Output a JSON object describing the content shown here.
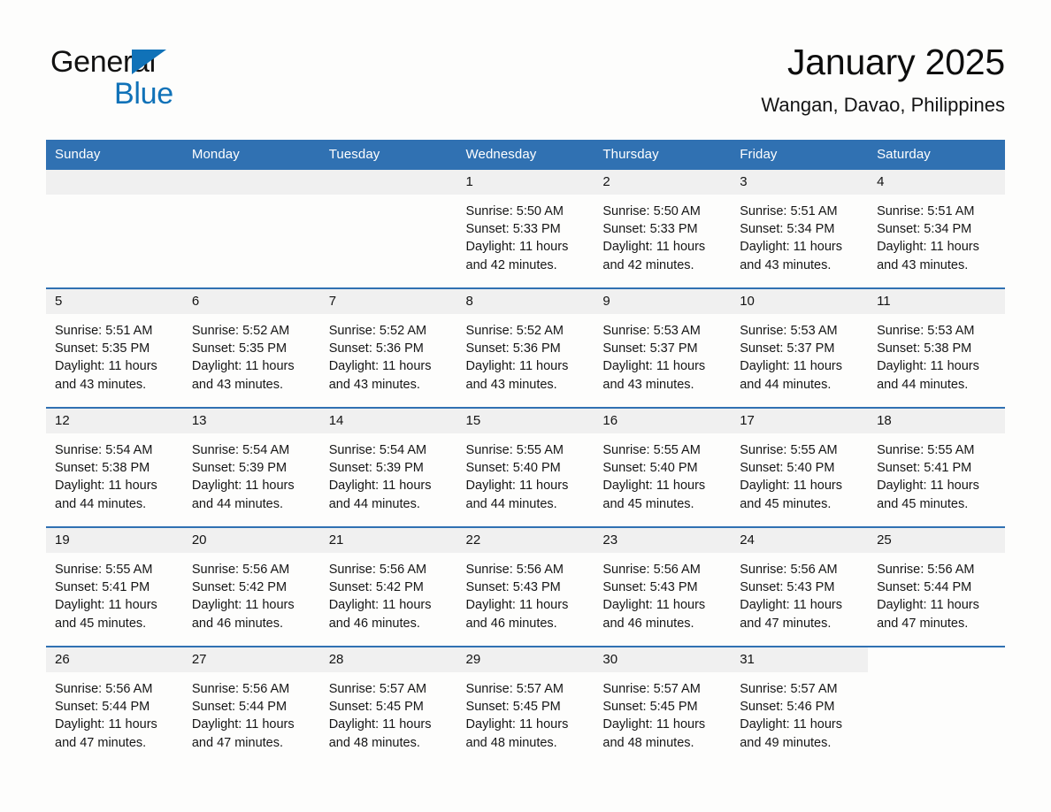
{
  "brand": {
    "name_part1": "General",
    "name_part2": "Blue"
  },
  "header": {
    "title": "January 2025",
    "location": "Wangan, Davao, Philippines"
  },
  "colors": {
    "header_blue": "#3071b2",
    "brand_blue": "#1072b8",
    "daynum_band": "#f0f0f0",
    "page_background": "#fdfdfc"
  },
  "weekdays": [
    "Sunday",
    "Monday",
    "Tuesday",
    "Wednesday",
    "Thursday",
    "Friday",
    "Saturday"
  ],
  "labels": {
    "sunrise_prefix": "Sunrise:",
    "sunset_prefix": "Sunset:",
    "daylight_prefix": "Daylight:"
  },
  "weeks": [
    [
      {
        "day": "",
        "blank": true
      },
      {
        "day": "",
        "blank": true
      },
      {
        "day": "",
        "blank": true
      },
      {
        "day": "1",
        "sunrise": "Sunrise: 5:50 AM",
        "sunset": "Sunset: 5:33 PM",
        "daylight": "Daylight: 11 hours and 42 minutes."
      },
      {
        "day": "2",
        "sunrise": "Sunrise: 5:50 AM",
        "sunset": "Sunset: 5:33 PM",
        "daylight": "Daylight: 11 hours and 42 minutes."
      },
      {
        "day": "3",
        "sunrise": "Sunrise: 5:51 AM",
        "sunset": "Sunset: 5:34 PM",
        "daylight": "Daylight: 11 hours and 43 minutes."
      },
      {
        "day": "4",
        "sunrise": "Sunrise: 5:51 AM",
        "sunset": "Sunset: 5:34 PM",
        "daylight": "Daylight: 11 hours and 43 minutes."
      }
    ],
    [
      {
        "day": "5",
        "sunrise": "Sunrise: 5:51 AM",
        "sunset": "Sunset: 5:35 PM",
        "daylight": "Daylight: 11 hours and 43 minutes."
      },
      {
        "day": "6",
        "sunrise": "Sunrise: 5:52 AM",
        "sunset": "Sunset: 5:35 PM",
        "daylight": "Daylight: 11 hours and 43 minutes."
      },
      {
        "day": "7",
        "sunrise": "Sunrise: 5:52 AM",
        "sunset": "Sunset: 5:36 PM",
        "daylight": "Daylight: 11 hours and 43 minutes."
      },
      {
        "day": "8",
        "sunrise": "Sunrise: 5:52 AM",
        "sunset": "Sunset: 5:36 PM",
        "daylight": "Daylight: 11 hours and 43 minutes."
      },
      {
        "day": "9",
        "sunrise": "Sunrise: 5:53 AM",
        "sunset": "Sunset: 5:37 PM",
        "daylight": "Daylight: 11 hours and 43 minutes."
      },
      {
        "day": "10",
        "sunrise": "Sunrise: 5:53 AM",
        "sunset": "Sunset: 5:37 PM",
        "daylight": "Daylight: 11 hours and 44 minutes."
      },
      {
        "day": "11",
        "sunrise": "Sunrise: 5:53 AM",
        "sunset": "Sunset: 5:38 PM",
        "daylight": "Daylight: 11 hours and 44 minutes."
      }
    ],
    [
      {
        "day": "12",
        "sunrise": "Sunrise: 5:54 AM",
        "sunset": "Sunset: 5:38 PM",
        "daylight": "Daylight: 11 hours and 44 minutes."
      },
      {
        "day": "13",
        "sunrise": "Sunrise: 5:54 AM",
        "sunset": "Sunset: 5:39 PM",
        "daylight": "Daylight: 11 hours and 44 minutes."
      },
      {
        "day": "14",
        "sunrise": "Sunrise: 5:54 AM",
        "sunset": "Sunset: 5:39 PM",
        "daylight": "Daylight: 11 hours and 44 minutes."
      },
      {
        "day": "15",
        "sunrise": "Sunrise: 5:55 AM",
        "sunset": "Sunset: 5:40 PM",
        "daylight": "Daylight: 11 hours and 44 minutes."
      },
      {
        "day": "16",
        "sunrise": "Sunrise: 5:55 AM",
        "sunset": "Sunset: 5:40 PM",
        "daylight": "Daylight: 11 hours and 45 minutes."
      },
      {
        "day": "17",
        "sunrise": "Sunrise: 5:55 AM",
        "sunset": "Sunset: 5:40 PM",
        "daylight": "Daylight: 11 hours and 45 minutes."
      },
      {
        "day": "18",
        "sunrise": "Sunrise: 5:55 AM",
        "sunset": "Sunset: 5:41 PM",
        "daylight": "Daylight: 11 hours and 45 minutes."
      }
    ],
    [
      {
        "day": "19",
        "sunrise": "Sunrise: 5:55 AM",
        "sunset": "Sunset: 5:41 PM",
        "daylight": "Daylight: 11 hours and 45 minutes."
      },
      {
        "day": "20",
        "sunrise": "Sunrise: 5:56 AM",
        "sunset": "Sunset: 5:42 PM",
        "daylight": "Daylight: 11 hours and 46 minutes."
      },
      {
        "day": "21",
        "sunrise": "Sunrise: 5:56 AM",
        "sunset": "Sunset: 5:42 PM",
        "daylight": "Daylight: 11 hours and 46 minutes."
      },
      {
        "day": "22",
        "sunrise": "Sunrise: 5:56 AM",
        "sunset": "Sunset: 5:43 PM",
        "daylight": "Daylight: 11 hours and 46 minutes."
      },
      {
        "day": "23",
        "sunrise": "Sunrise: 5:56 AM",
        "sunset": "Sunset: 5:43 PM",
        "daylight": "Daylight: 11 hours and 46 minutes."
      },
      {
        "day": "24",
        "sunrise": "Sunrise: 5:56 AM",
        "sunset": "Sunset: 5:43 PM",
        "daylight": "Daylight: 11 hours and 47 minutes."
      },
      {
        "day": "25",
        "sunrise": "Sunrise: 5:56 AM",
        "sunset": "Sunset: 5:44 PM",
        "daylight": "Daylight: 11 hours and 47 minutes."
      }
    ],
    [
      {
        "day": "26",
        "sunrise": "Sunrise: 5:56 AM",
        "sunset": "Sunset: 5:44 PM",
        "daylight": "Daylight: 11 hours and 47 minutes."
      },
      {
        "day": "27",
        "sunrise": "Sunrise: 5:56 AM",
        "sunset": "Sunset: 5:44 PM",
        "daylight": "Daylight: 11 hours and 47 minutes."
      },
      {
        "day": "28",
        "sunrise": "Sunrise: 5:57 AM",
        "sunset": "Sunset: 5:45 PM",
        "daylight": "Daylight: 11 hours and 48 minutes."
      },
      {
        "day": "29",
        "sunrise": "Sunrise: 5:57 AM",
        "sunset": "Sunset: 5:45 PM",
        "daylight": "Daylight: 11 hours and 48 minutes."
      },
      {
        "day": "30",
        "sunrise": "Sunrise: 5:57 AM",
        "sunset": "Sunset: 5:45 PM",
        "daylight": "Daylight: 11 hours and 48 minutes."
      },
      {
        "day": "31",
        "sunrise": "Sunrise: 5:57 AM",
        "sunset": "Sunset: 5:46 PM",
        "daylight": "Daylight: 11 hours and 49 minutes."
      },
      {
        "day": "",
        "noday": true
      }
    ]
  ]
}
